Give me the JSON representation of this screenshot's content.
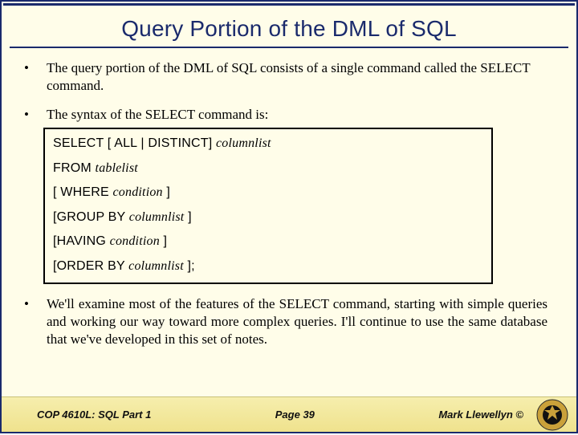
{
  "title": "Query Portion of the DML of SQL",
  "bullets": {
    "b1": "The query portion of the DML of SQL consists of a single command called the SELECT command.",
    "b2": "The syntax of the SELECT command is:",
    "b3": "We'll examine most of the features of the SELECT command, starting with simple queries and working our way toward more complex queries.  I'll continue to use the same database that we've developed in this set of notes."
  },
  "syntax": {
    "l1a": "SELECT [ ALL | DISTINCT] ",
    "l1b": "columnlist",
    "l2a": "FROM ",
    "l2b": "tablelist",
    "l3a": "[ WHERE ",
    "l3b": "condition",
    "l3c": " ]",
    "l4a": "[GROUP BY  ",
    "l4b": "columnlist",
    "l4c": " ]",
    "l5a": "[HAVING ",
    "l5b": "condition",
    "l5c": " ]",
    "l6a": "[ORDER BY ",
    "l6b": "columnlist",
    "l6c": " ];"
  },
  "footer": {
    "course": "COP 4610L: SQL Part 1",
    "page": "Page 39",
    "author": "Mark Llewellyn ©"
  }
}
